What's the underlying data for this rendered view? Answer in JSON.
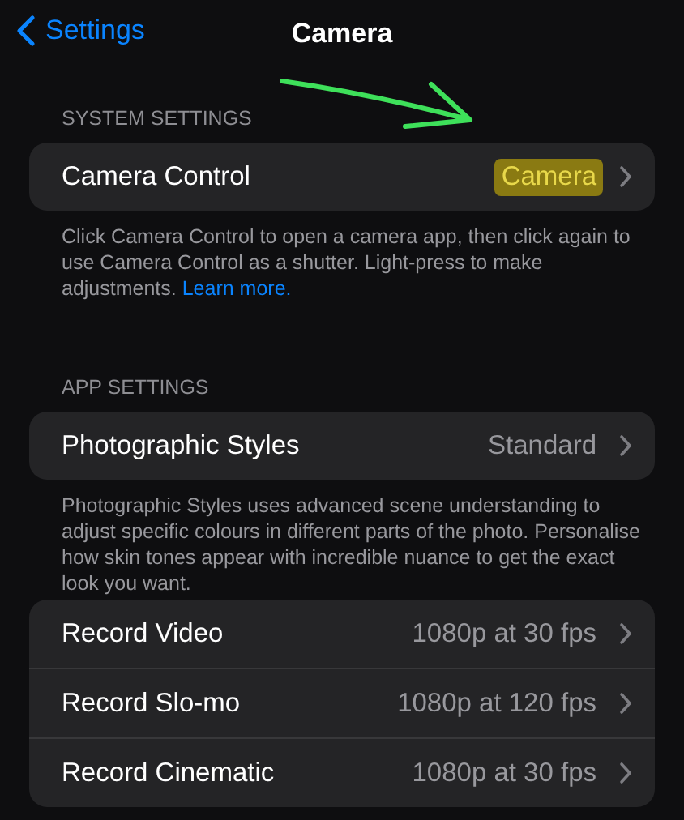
{
  "nav": {
    "back": "Settings",
    "title": "Camera"
  },
  "sections": [
    {
      "header": "SYSTEM SETTINGS",
      "rows": [
        {
          "label": "Camera Control",
          "value": "Camera",
          "highlighted": true
        }
      ],
      "footer": "Click Camera Control to open a camera app, then click again to use Camera Control as a shutter. Light-press to make adjustments.",
      "footer_link": "Learn more."
    },
    {
      "header": "APP SETTINGS",
      "rows": [
        {
          "label": "Photographic Styles",
          "value": "Standard",
          "highlighted": false
        }
      ],
      "footer": "Photographic Styles uses advanced scene understanding to adjust specific colours in different parts of the photo. Personalise how skin tones appear with incredible nuance to get the exact look you want."
    },
    {
      "rows": [
        {
          "label": "Record Video",
          "value": "1080p at 30 fps",
          "highlighted": false
        },
        {
          "label": "Record Slo-mo",
          "value": "1080p at 120 fps",
          "highlighted": false
        },
        {
          "label": "Record Cinematic",
          "value": "1080p at 30 fps",
          "highlighted": false
        }
      ]
    }
  ]
}
